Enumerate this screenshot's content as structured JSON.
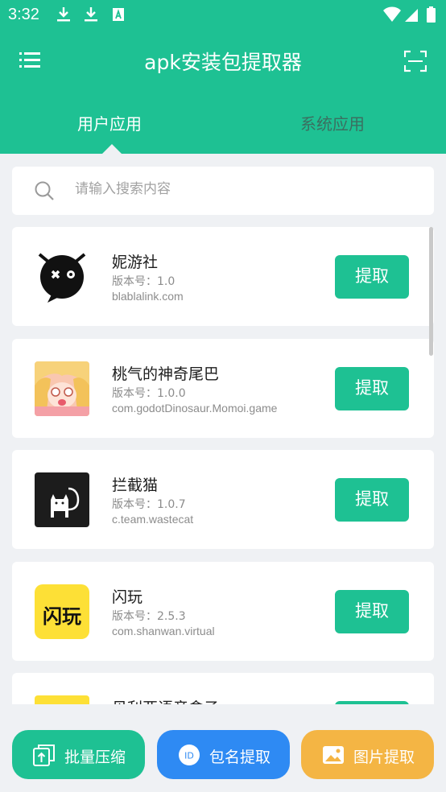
{
  "status_bar": {
    "time": "3:32"
  },
  "app_bar": {
    "title": "apk安装包提取器"
  },
  "tabs": [
    {
      "label": "用户应用",
      "active": true
    },
    {
      "label": "系统应用",
      "active": false
    }
  ],
  "search": {
    "placeholder": "请输入搜索内容"
  },
  "apps": [
    {
      "name": "妮游社",
      "version": "版本号：1.0",
      "package": "blablalink.com",
      "icon": "niyoushe-icon"
    },
    {
      "name": "桃气的神奇尾巴",
      "version": "版本号：1.0.0",
      "package": "com.godotDinosaur.Momoi.game",
      "icon": "momoi-icon"
    },
    {
      "name": "拦截猫",
      "version": "版本号：1.0.7",
      "package": "c.team.wastecat",
      "icon": "cat-icon"
    },
    {
      "name": "闪玩",
      "version": "版本号：2.5.3",
      "package": "com.shanwan.virtual",
      "icon": "shanwan-icon",
      "icon_text": "闪玩"
    },
    {
      "name": "贝利亚语音盒子",
      "version": "",
      "package": "",
      "icon": "belial-icon"
    }
  ],
  "extract_label": "提取",
  "bottom_actions": {
    "batch": "批量压缩",
    "pkg": "包名提取",
    "pkg_badge": "ID",
    "image": "图片提取"
  },
  "colors": {
    "accent": "#1ec193",
    "blue": "#2e8af3",
    "orange": "#f4b544"
  }
}
